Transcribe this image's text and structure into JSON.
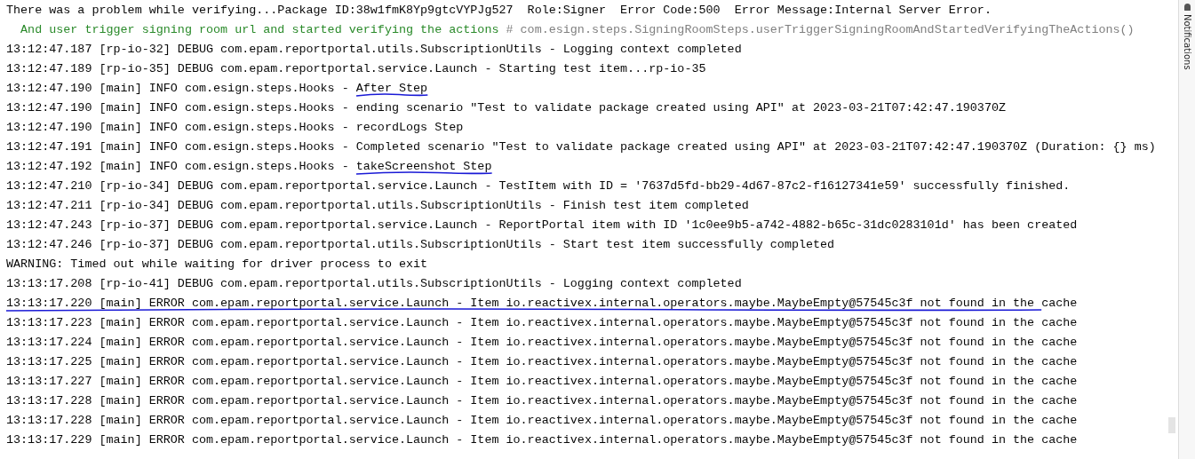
{
  "console": {
    "lines": [
      {
        "kind": "plain",
        "text": "There was a problem while verifying...Package ID:38w1fmK8Yp9gtcVYPJg527  Role:Signer  Error Code:500  Error Message:Internal Server Error."
      },
      {
        "kind": "step",
        "text": "  And user trigger signing room url and started verifying the actions ",
        "comment": "# com.esign.steps.SigningRoomSteps.userTriggerSigningRoomAndStartedVerifyingTheActions()"
      },
      {
        "kind": "plain",
        "text": "13:12:47.187 [rp-io-32] DEBUG com.epam.reportportal.utils.SubscriptionUtils - Logging context completed"
      },
      {
        "kind": "plain",
        "text": "13:12:47.189 [rp-io-35] DEBUG com.epam.reportportal.service.Launch - Starting test item...rp-io-35"
      },
      {
        "kind": "plain",
        "text": "13:12:47.190 [main] INFO com.esign.steps.Hooks - After Step",
        "underlined": true
      },
      {
        "kind": "plain",
        "text": "13:12:47.190 [main] INFO com.esign.steps.Hooks - ending scenario \"Test to validate package created using API\" at 2023-03-21T07:42:47.190370Z"
      },
      {
        "kind": "plain",
        "text": "13:12:47.190 [main] INFO com.esign.steps.Hooks - recordLogs Step"
      },
      {
        "kind": "plain",
        "text": "13:12:47.191 [main] INFO com.esign.steps.Hooks - Completed scenario \"Test to validate package created using API\" at 2023-03-21T07:42:47.190370Z (Duration: {} ms)"
      },
      {
        "kind": "plain",
        "text": "13:12:47.192 [main] INFO com.esign.steps.Hooks - takeScreenshot Step",
        "underlined": true
      },
      {
        "kind": "plain",
        "text": "13:12:47.210 [rp-io-34] DEBUG com.epam.reportportal.service.Launch - TestItem with ID = '7637d5fd-bb29-4d67-87c2-f16127341e59' successfully finished."
      },
      {
        "kind": "plain",
        "text": "13:12:47.211 [rp-io-34] DEBUG com.epam.reportportal.utils.SubscriptionUtils - Finish test item completed"
      },
      {
        "kind": "plain",
        "text": "13:12:47.243 [rp-io-37] DEBUG com.epam.reportportal.service.Launch - ReportPortal item with ID '1c0ee9b5-a742-4882-b65c-31dc0283101d' has been created"
      },
      {
        "kind": "plain",
        "text": "13:12:47.246 [rp-io-37] DEBUG com.epam.reportportal.utils.SubscriptionUtils - Start test item successfully completed"
      },
      {
        "kind": "plain",
        "text": "WARNING: Timed out while waiting for driver process to exit"
      },
      {
        "kind": "plain",
        "text": "13:13:17.208 [rp-io-41] DEBUG com.epam.reportportal.utils.SubscriptionUtils - Logging context completed"
      },
      {
        "kind": "plain",
        "text": "13:13:17.220 [main] ERROR com.epam.reportportal.service.Launch - Item io.reactivex.internal.operators.maybe.MaybeEmpty@57545c3f not found in the cache",
        "underlined": true,
        "underline_from_line_start": true
      },
      {
        "kind": "plain",
        "text": "13:13:17.223 [main] ERROR com.epam.reportportal.service.Launch - Item io.reactivex.internal.operators.maybe.MaybeEmpty@57545c3f not found in the cache"
      },
      {
        "kind": "plain",
        "text": "13:13:17.224 [main] ERROR com.epam.reportportal.service.Launch - Item io.reactivex.internal.operators.maybe.MaybeEmpty@57545c3f not found in the cache"
      },
      {
        "kind": "plain",
        "text": "13:13:17.225 [main] ERROR com.epam.reportportal.service.Launch - Item io.reactivex.internal.operators.maybe.MaybeEmpty@57545c3f not found in the cache"
      },
      {
        "kind": "plain",
        "text": "13:13:17.227 [main] ERROR com.epam.reportportal.service.Launch - Item io.reactivex.internal.operators.maybe.MaybeEmpty@57545c3f not found in the cache"
      },
      {
        "kind": "plain",
        "text": "13:13:17.228 [main] ERROR com.epam.reportportal.service.Launch - Item io.reactivex.internal.operators.maybe.MaybeEmpty@57545c3f not found in the cache"
      },
      {
        "kind": "plain",
        "text": "13:13:17.228 [main] ERROR com.epam.reportportal.service.Launch - Item io.reactivex.internal.operators.maybe.MaybeEmpty@57545c3f not found in the cache"
      },
      {
        "kind": "plain",
        "text": "13:13:17.229 [main] ERROR com.epam.reportportal.service.Launch - Item io.reactivex.internal.operators.maybe.MaybeEmpty@57545c3f not found in the cache"
      }
    ]
  },
  "side_panel": {
    "label": "Notifications"
  }
}
